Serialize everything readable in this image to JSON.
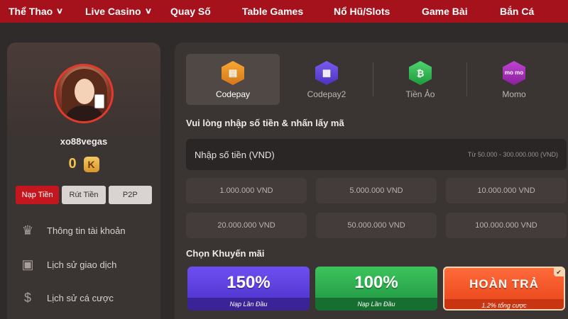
{
  "nav": {
    "items": [
      {
        "label": "Thể Thao",
        "chevron": true
      },
      {
        "label": "Live Casino",
        "chevron": true
      },
      {
        "label": "Quay Số",
        "chevron": false
      },
      {
        "label": "Table Games",
        "chevron": false
      },
      {
        "label": "Nổ Hũ/Slots",
        "chevron": false
      },
      {
        "label": "Game Bài",
        "chevron": false
      },
      {
        "label": "Bắn Cá",
        "chevron": false
      }
    ],
    "chevron_glyph": "∨",
    "background": "#a5121b"
  },
  "profile": {
    "username": "xo88vegas",
    "balance": "0",
    "currency_badge": "K",
    "buttons": {
      "deposit": "Nạp Tiền",
      "withdraw": "Rút Tiền",
      "p2p": "P2P"
    },
    "menu": [
      {
        "label": "Thông tin tài khoản",
        "icon": "crown-icon",
        "glyph": "♛"
      },
      {
        "label": "Lịch sử giao dịch",
        "icon": "wallet-icon",
        "glyph": "▣"
      },
      {
        "label": "Lịch sử cá cược",
        "icon": "money-bag-icon",
        "glyph": "$"
      }
    ]
  },
  "payment": {
    "methods": [
      {
        "label": "Codepay",
        "icon": "wallet-icon",
        "glyph": "▤",
        "active": true
      },
      {
        "label": "Codepay2",
        "icon": "scan-icon",
        "glyph": "▦",
        "active": false
      },
      {
        "label": "Tiền Ảo",
        "icon": "bitcoin-icon",
        "glyph": "₿",
        "active": false
      },
      {
        "label": "Momo",
        "icon": "momo-icon",
        "glyph": "mo mo",
        "active": false
      }
    ],
    "amount_title": "Vui lòng nhập số tiền & nhấn lấy mã",
    "amount_placeholder": "Nhập số tiền (VND)",
    "amount_range": "Từ 50.000 - 300.000.000 (VND)",
    "quick_amounts": [
      "1.000.000 VND",
      "5.000.000 VND",
      "10.000.000 VND",
      "20.000.000 VND",
      "50.000.000 VND",
      "100.000.000 VND"
    ],
    "promo_title": "Chọn Khuyến mãi",
    "promos": [
      {
        "big": "150%",
        "small": "Nạp Lần Đầu",
        "color": "purple"
      },
      {
        "big": "100%",
        "small": "Nạp Lần Đầu",
        "color": "green"
      },
      {
        "big": "HOÀN TRẢ",
        "small": "1.2% tổng cược",
        "color": "orange",
        "selected": true
      }
    ],
    "check_glyph": "✔"
  }
}
